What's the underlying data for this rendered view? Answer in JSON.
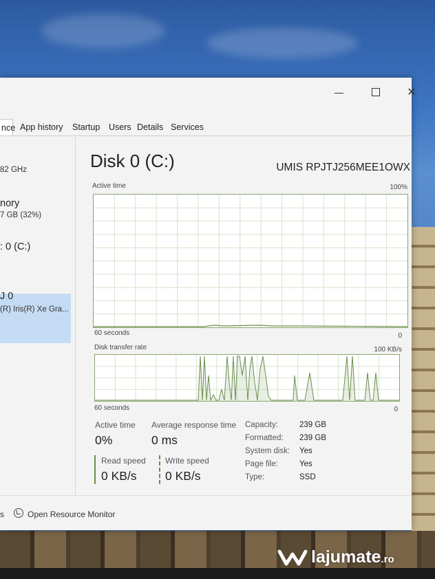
{
  "window": {
    "tabs": [
      {
        "label": "nce",
        "active": true
      },
      {
        "label": "App history"
      },
      {
        "label": "Startup"
      },
      {
        "label": "Users"
      },
      {
        "label": "Details"
      },
      {
        "label": "Services"
      }
    ]
  },
  "sidebar": {
    "items": [
      {
        "sub": "82 GHz"
      },
      {
        "title": "nory",
        "sub": "7 GB (32%)"
      },
      {
        "title": ": 0 (C:)",
        "selected": true
      },
      {
        "title": "J 0",
        "sub": "(R) Iris(R) Xe Gra..."
      }
    ]
  },
  "disk": {
    "title": "Disk 0 (C:)",
    "model": "UMIS RPJTJ256MEE1OWX",
    "active_time_graph": {
      "label": "Active time",
      "max_label": "100%",
      "time_label": "60 seconds",
      "min_label": "0"
    },
    "transfer_graph": {
      "label": "Disk transfer rate",
      "max_label": "100 KB/s",
      "time_label": "60 seconds",
      "min_label": "0"
    },
    "stats": {
      "active_time_label": "Active time",
      "active_time_value": "0%",
      "avg_response_label": "Average response time",
      "avg_response_value": "0 ms",
      "read_speed_label": "Read speed",
      "read_speed_value": "0 KB/s",
      "write_speed_label": "Write speed",
      "write_speed_value": "0 KB/s"
    },
    "properties": [
      {
        "label": "Capacity:",
        "value": "239 GB"
      },
      {
        "label": "Formatted:",
        "value": "239 GB"
      },
      {
        "label": "System disk:",
        "value": "Yes"
      },
      {
        "label": "Page file:",
        "value": "Yes"
      },
      {
        "label": "Type:",
        "value": "SSD"
      }
    ]
  },
  "footer": {
    "left": "s",
    "resource_monitor": "Open Resource Monitor"
  },
  "watermark": {
    "text": "lajumate",
    "suffix": ".ro"
  },
  "colors": {
    "graph_line": "#6a8f4d",
    "graph_grid": "#d7e3cc",
    "selection": "#c4dcf3"
  }
}
